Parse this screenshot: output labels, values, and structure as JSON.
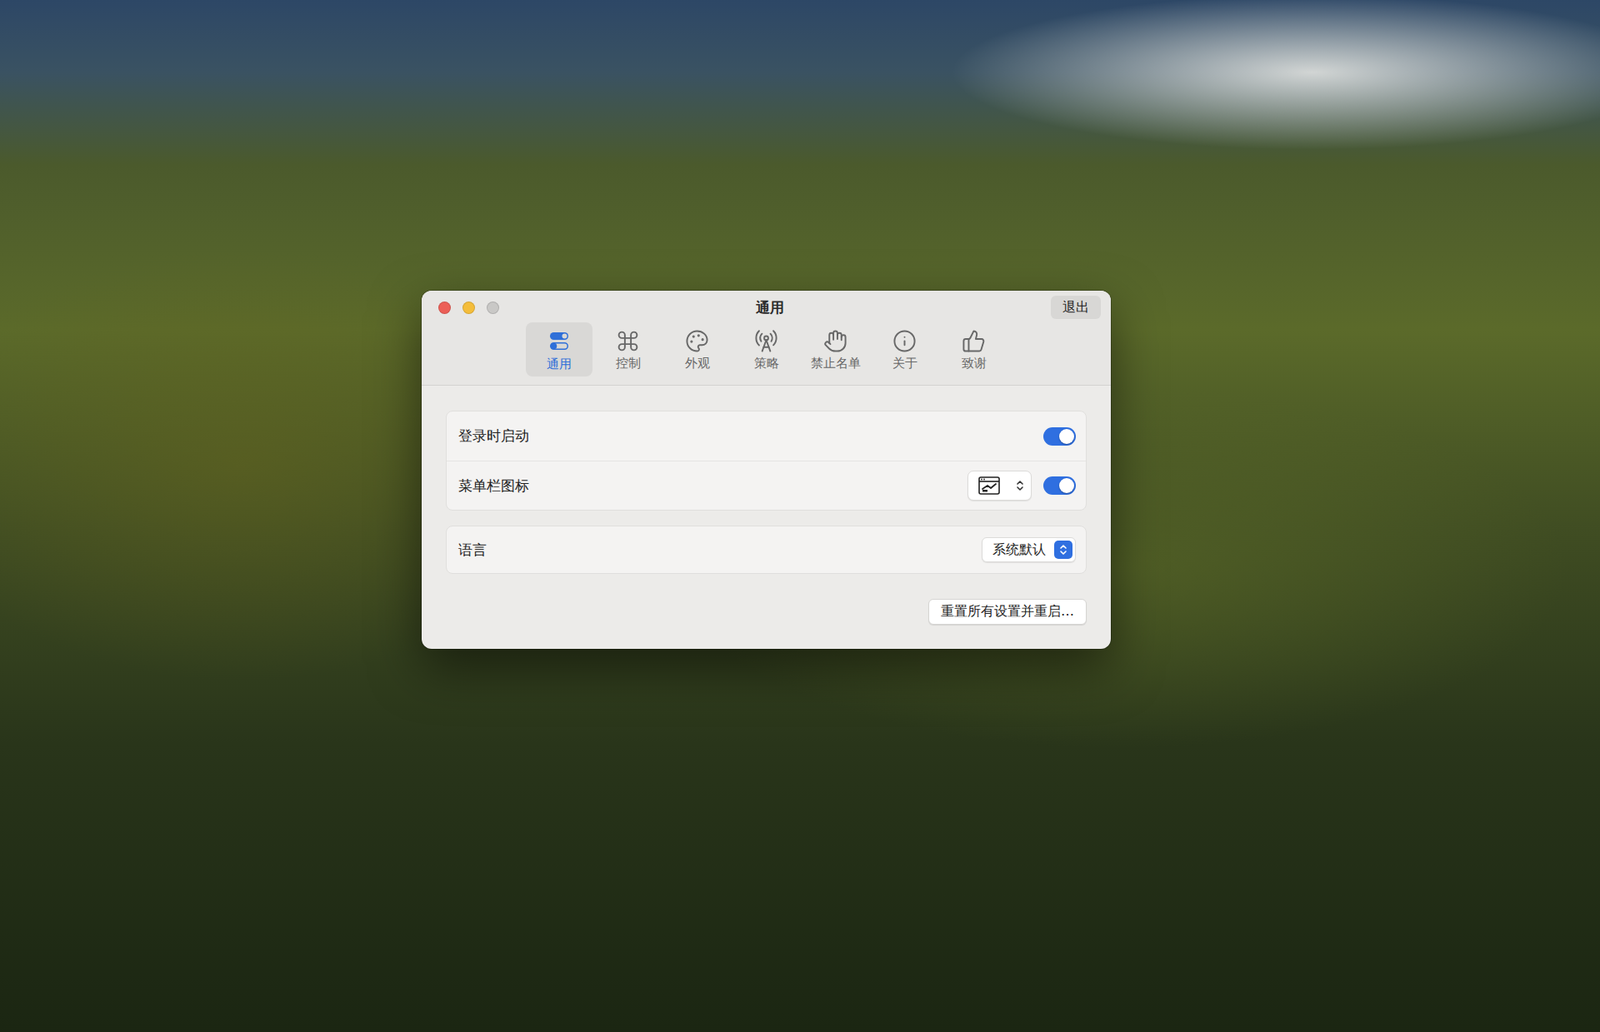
{
  "window": {
    "title": "通用",
    "quit_button": "退出",
    "traffic_lights": [
      {
        "name": "close",
        "enabled": true,
        "color": "#ec5f57"
      },
      {
        "name": "minimize",
        "enabled": true,
        "color": "#f4bd3b"
      },
      {
        "name": "zoom",
        "enabled": false,
        "color": "#c9c8c6"
      }
    ]
  },
  "tabs": [
    {
      "label": "通用",
      "selected": true,
      "icon": "general"
    },
    {
      "label": "控制",
      "selected": false,
      "icon": "command"
    },
    {
      "label": "外观",
      "selected": false,
      "icon": "palette"
    },
    {
      "label": "策略",
      "selected": false,
      "icon": "antenna"
    },
    {
      "label": "禁止名单",
      "selected": false,
      "icon": "hand"
    },
    {
      "label": "关于",
      "selected": false,
      "icon": "info"
    },
    {
      "label": "致谢",
      "selected": false,
      "icon": "thumbs-up"
    }
  ],
  "settings_groups": [
    {
      "rows": [
        {
          "label": "登录时启动",
          "kind": "toggle",
          "on": true
        },
        {
          "label": "菜单栏图标",
          "kind": "icon-toggle",
          "on": true
        }
      ]
    },
    {
      "rows": [
        {
          "label": "语言",
          "kind": "popup",
          "value": "系统默认"
        }
      ]
    }
  ],
  "buttons": [
    "重置所有设置并重启…"
  ]
}
